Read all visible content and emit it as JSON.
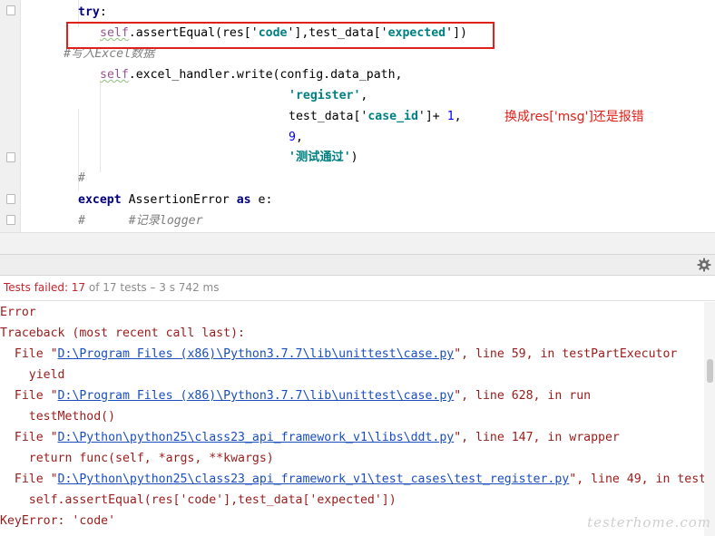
{
  "editor": {
    "lines": {
      "l1": {
        "kw": "try",
        "rest": ":"
      },
      "l2": {
        "self": "self",
        "a": ".assertEqual(res['",
        "s1": "code",
        "b": "'],test_data['",
        "s2": "expected",
        "c": "'])"
      },
      "l3": {
        "comment": "#写入Excel数据"
      },
      "l4": {
        "self": "self",
        "rest": ".excel_handler.write(config.data_path,"
      },
      "l5": {
        "str": "'register'",
        "rest": ","
      },
      "l6": {
        "a": "test_data['",
        "s": "case_id",
        "b": "']+ ",
        "num": "1",
        "c": ","
      },
      "l7": {
        "num": "9",
        "rest": ","
      },
      "l8": {
        "str": "'测试通过'",
        "rest": ")"
      },
      "l9": {
        "comment": "#"
      },
      "l10": {
        "kw1": "except",
        "cls": " AssertionError ",
        "kw2": "as",
        "rest": " e:"
      },
      "l11": {
        "comment": "#      #记录logger"
      }
    },
    "annotation": "换成res['msg']还是报错"
  },
  "status": {
    "failed": "Tests failed: 17",
    "rest": " of 17 tests – 3 s 742 ms"
  },
  "console": {
    "error": "Error",
    "traceback": "Traceback (most recent call last):",
    "frames": [
      {
        "prefix": "  File \"",
        "path": "D:\\Program Files (x86)\\Python3.7.7\\lib\\unittest\\case.py",
        "suffix": "\", line 59, in testPartExecutor",
        "code": "    yield"
      },
      {
        "prefix": "  File \"",
        "path": "D:\\Program Files (x86)\\Python3.7.7\\lib\\unittest\\case.py",
        "suffix": "\", line 628, in run",
        "code": "    testMethod()"
      },
      {
        "prefix": "  File \"",
        "path": "D:\\Python\\python25\\class23_api_framework_v1\\libs\\ddt.py",
        "suffix": "\", line 147, in wrapper",
        "code": "    return func(self, *args, **kwargs)"
      },
      {
        "prefix": "  File \"",
        "path": "D:\\Python\\python25\\class23_api_framework_v1\\test_cases\\test_register.py",
        "suffix": "\", line 49, in test_register",
        "code": "    self.assertEqual(res['code'],test_data['expected'])"
      }
    ],
    "key_error": "KeyError: 'code'"
  },
  "watermark": "testerhome.com",
  "icons": {
    "settings": "gear-icon",
    "fold": "fold-marker-icon"
  },
  "colors": {
    "error_red": "#c7222d",
    "annotation_red": "#e0201a",
    "link_blue": "#1a4ebf",
    "trace_text": "#9b1b1b"
  }
}
